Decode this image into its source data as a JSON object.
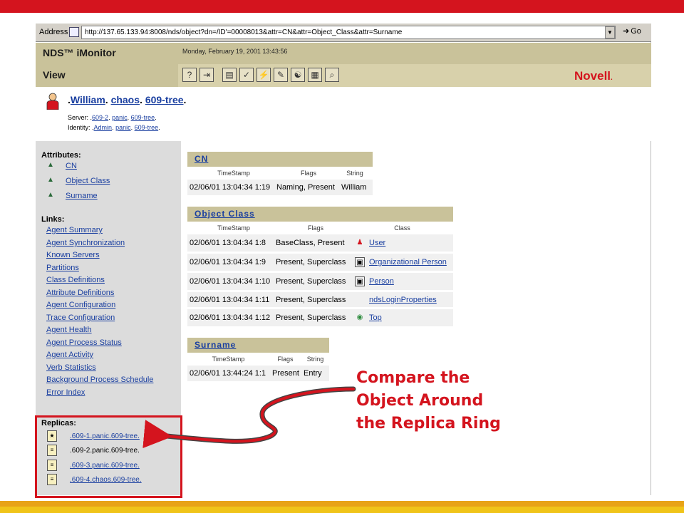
{
  "browser": {
    "address_label": "Address",
    "url": "http://137.65.133.94:8008/nds/object?dn=/ID'=00008013&attr=CN&attr=Object_Class&attr=Surname",
    "go_label": "Go"
  },
  "imonitor": {
    "title": "NDS™ iMonitor",
    "view_label": "View",
    "date": "Monday, February 19, 2001 13:43:56",
    "brand": "Novell",
    "toolbar_icons": [
      "help-icon",
      "exit-icon",
      "print-icon",
      "configure-icon",
      "repair-icon",
      "tools-icon",
      "agent-icon",
      "report-icon",
      "search-icon"
    ]
  },
  "object": {
    "name_parts": [
      "William",
      "chaos",
      "609-tree"
    ],
    "server_label": "Server:",
    "server_parts": [
      "609-2",
      "panic",
      "609-tree"
    ],
    "identity_label": "Identity:",
    "identity_parts": [
      "Admin",
      "panic",
      "609-tree"
    ]
  },
  "sidebar": {
    "attributes_heading": "Attributes:",
    "attributes": [
      "CN",
      "Object Class",
      "Surname"
    ],
    "links_heading": "Links:",
    "links": [
      "Agent Summary",
      "Agent Synchronization",
      "Known Servers",
      "Partitions",
      "Class Definitions",
      "Attribute Definitions",
      "Agent Configuration",
      "Trace Configuration",
      "Agent Health",
      "Agent Process Status",
      "Agent Activity",
      "Verb Statistics",
      "Background Process Schedule",
      "Error Index"
    ],
    "replicas_heading": "Replicas:",
    "replicas": [
      ".609-1.panic.609-tree.",
      ".609-2.panic.609-tree.",
      ".609-3.panic.609-tree.",
      ".609-4.chaos.609-tree."
    ]
  },
  "cn_panel": {
    "title": "CN",
    "col_timestamp": "TimeStamp",
    "col_flags": "Flags",
    "col_string": "String",
    "rows": [
      {
        "timestamp": "02/06/01 13:04:34 1:19",
        "flags": "Naming, Present",
        "value": "William"
      }
    ]
  },
  "objclass_panel": {
    "title": "Object Class",
    "col_timestamp": "TimeStamp",
    "col_flags": "Flags",
    "col_class": "Class",
    "rows": [
      {
        "timestamp": "02/06/01 13:04:34 1:8",
        "flags": "BaseClass, Present",
        "class": "User",
        "icon": "user-icon"
      },
      {
        "timestamp": "02/06/01 13:04:34 1:9",
        "flags": "Present, Superclass",
        "class": "Organizational Person",
        "icon": "org-person-icon"
      },
      {
        "timestamp": "02/06/01 13:04:34 1:10",
        "flags": "Present, Superclass",
        "class": "Person",
        "icon": "person-icon"
      },
      {
        "timestamp": "02/06/01 13:04:34 1:11",
        "flags": "Present, Superclass",
        "class": "ndsLoginProperties",
        "icon": ""
      },
      {
        "timestamp": "02/06/01 13:04:34 1:12",
        "flags": "Present, Superclass",
        "class": "Top",
        "icon": "globe-icon"
      }
    ]
  },
  "surname_panel": {
    "title": "Surname",
    "col_timestamp": "TimeStamp",
    "col_flags": "Flags",
    "col_string": "String",
    "rows": [
      {
        "timestamp": "02/06/01 13:44:24 1:1",
        "flags": "Present",
        "value": "Entry"
      }
    ]
  },
  "callout": {
    "lines": [
      "Compare the",
      "Object Around",
      "the Replica Ring"
    ],
    "color": "#d4141e"
  },
  "colors": {
    "accent_red": "#d4141e",
    "header_tan": "#c9c29a",
    "link_blue": "#1a3fa0",
    "sidebar_gray": "#dcdcdc"
  }
}
